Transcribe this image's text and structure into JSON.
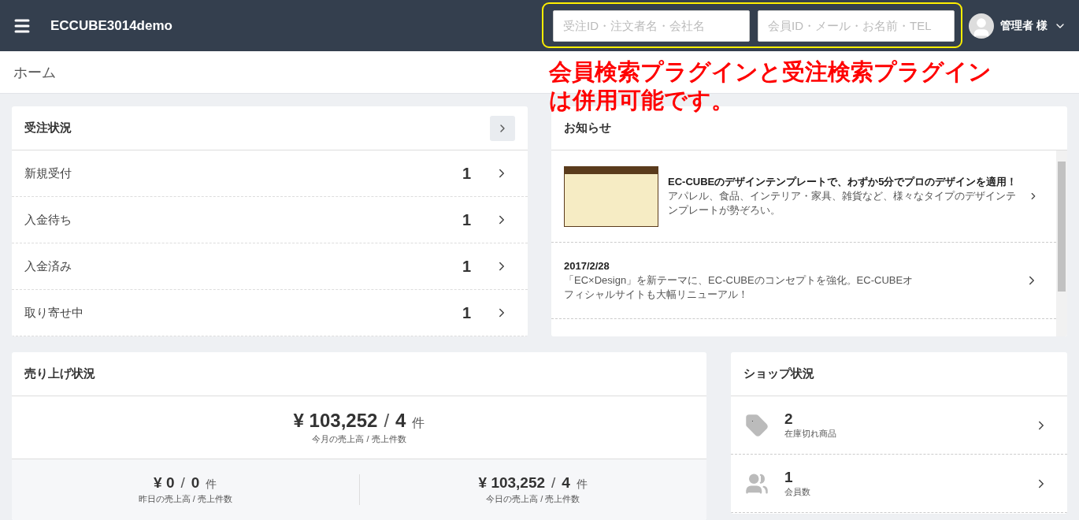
{
  "header": {
    "brand": "ECCUBE3014demo",
    "search_fields": [
      {
        "placeholder": "受注ID・注文者名・会社名"
      },
      {
        "placeholder": "会員ID・メール・お名前・TEL"
      }
    ],
    "user": {
      "name": "管理者 様"
    }
  },
  "breadcrumb": "ホーム",
  "annotation": {
    "text": "会員検索プラグインと受注検索プラグインは併用可能です。"
  },
  "order_status": {
    "title": "受注状況",
    "rows": [
      {
        "label": "新規受付",
        "count": "1"
      },
      {
        "label": "入金待ち",
        "count": "1"
      },
      {
        "label": "入金済み",
        "count": "1"
      },
      {
        "label": "取り寄せ中",
        "count": "1"
      }
    ]
  },
  "news": {
    "title": "お知らせ",
    "items": [
      {
        "kind": "banner",
        "title": "EC-CUBEのデザインテンプレートで、わずか5分でプロのデザインを適用！",
        "body": "アパレル、食品、インテリア・家具、雑貨など、様々なタイプのデザインテンプレートが勢ぞろい。"
      },
      {
        "kind": "dated",
        "date": "2017/2/28",
        "body": "「EC×Design」を新テーマに、EC-CUBEのコンセプトを強化。EC-CUBEオフィシャルサイトも大幅リニューアル！"
      }
    ]
  },
  "sales": {
    "title": "売り上げ状況",
    "main": {
      "amount": "¥ 103,252",
      "separator": "/",
      "count": "4",
      "unit": "件",
      "caption": "今月の売上高 / 売上件数"
    },
    "sub": [
      {
        "amount": "¥ 0",
        "separator": "/",
        "count": "0",
        "unit": "件",
        "caption": "昨日の売上高 / 売上件数"
      },
      {
        "amount": "¥ 103,252",
        "separator": "/",
        "count": "4",
        "unit": "件",
        "caption": "今日の売上高 / 売上件数"
      }
    ]
  },
  "shop_status": {
    "title": "ショップ状況",
    "items": [
      {
        "kind": "out_of_stock",
        "count": "2",
        "label": "在庫切れ商品"
      },
      {
        "kind": "members",
        "count": "1",
        "label": "会員数"
      }
    ]
  }
}
